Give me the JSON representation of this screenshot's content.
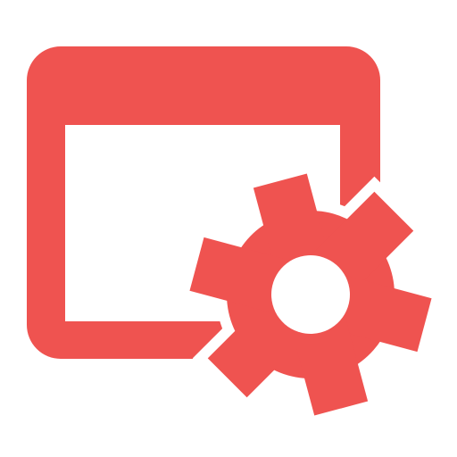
{
  "icon": {
    "name": "window-settings-icon",
    "color": "#EF5350",
    "background": "#FFFFFF",
    "parts": [
      "app-window-icon",
      "gear-icon"
    ]
  }
}
